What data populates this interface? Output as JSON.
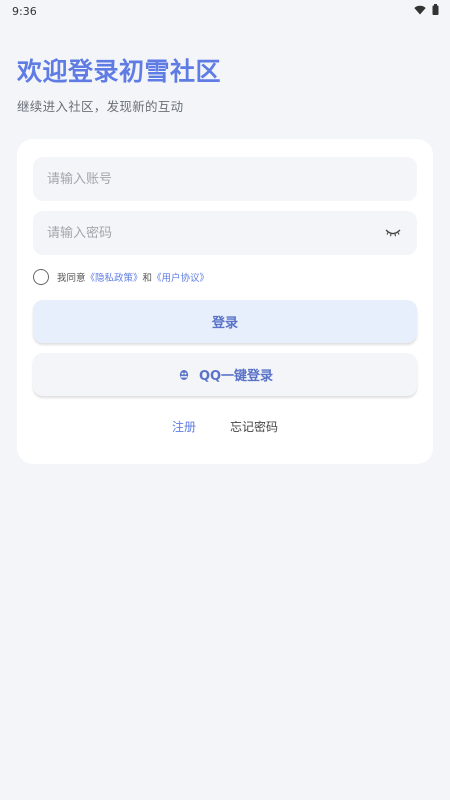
{
  "status_bar": {
    "time": "9:36"
  },
  "header": {
    "title": "欢迎登录初雪社区",
    "subtitle": "继续进入社区，发现新的互动"
  },
  "form": {
    "account_placeholder": "请输入账号",
    "password_placeholder": "请输入密码",
    "agreement": {
      "prefix": "我同意",
      "privacy_link": "《隐私政策》",
      "conjunction": "和",
      "terms_link": "《用户协议》"
    },
    "login_label": "登录",
    "qq_login_label": "QQ一键登录"
  },
  "links": {
    "register": "注册",
    "forgot_password": "忘记密码"
  },
  "colors": {
    "accent": "#5f7ce4",
    "page_bg": "#f3f5f8",
    "login_bg": "#e7eefc"
  },
  "icons": {
    "wifi": "wifi-icon",
    "battery": "battery-icon",
    "password_toggle": "eye-closed-icon",
    "qq": "qq-penguin-icon"
  }
}
